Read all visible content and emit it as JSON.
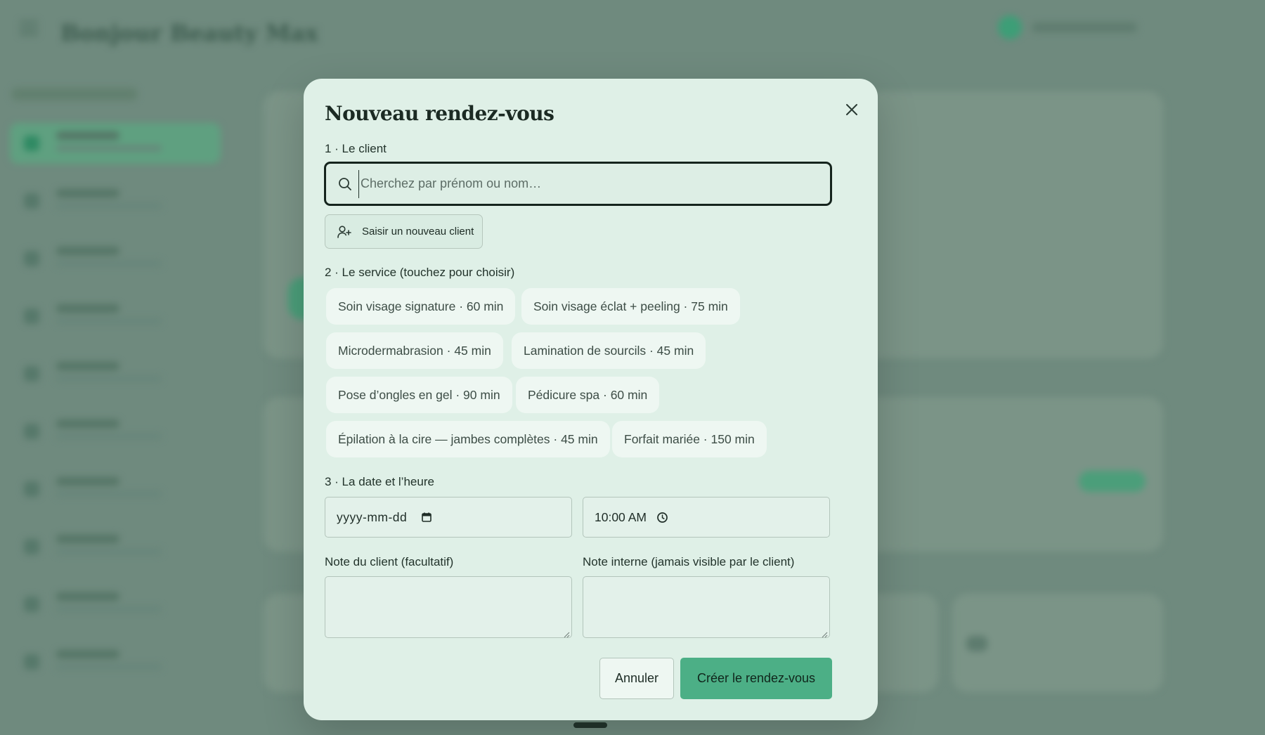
{
  "background_app": {
    "brand": "Bonjour Beauty Max"
  },
  "modal": {
    "title": "Nouveau rendez-vous",
    "close_icon": "close-icon",
    "section_client": "1 · Le client",
    "search": {
      "placeholder": "Cherchez par prénom ou nom…",
      "value": "",
      "icon": "search-icon"
    },
    "new_client_button": {
      "label": "Saisir un nouveau client",
      "icon": "user-plus-icon"
    },
    "section_service": "2 · Le service (touchez pour choisir)",
    "services": [
      {
        "label": "Soin visage signature · 60 min"
      },
      {
        "label": "Soin visage éclat + peeling · 75 min"
      },
      {
        "label": "Microdermabrasion · 45 min"
      },
      {
        "label": "Lamination de sourcils · 45 min"
      },
      {
        "label": "Pose d’ongles en gel · 90 min"
      },
      {
        "label": "Pédicure spa · 60 min"
      },
      {
        "label": "Épilation à la cire — jambes complètes · 45 min"
      },
      {
        "label": "Forfait mariée · 150 min"
      }
    ],
    "section_datetime": "3 · La date et l’heure",
    "date_field": {
      "value": "yyyy-mm-dd",
      "icon": "calendar-icon"
    },
    "time_field": {
      "value": "10:00 AM",
      "icon": "clock-icon"
    },
    "client_note_label": "Note du client (facultatif)",
    "internal_note_label": "Note interne (jamais visible par le client)",
    "client_note_value": "",
    "internal_note_value": "",
    "cancel_label": "Annuler",
    "create_label": "Créer le rendez-vous"
  },
  "colors": {
    "modal_bg": "#dff0e7",
    "accent": "#4caf86",
    "overlay": "#6f8a7e"
  }
}
